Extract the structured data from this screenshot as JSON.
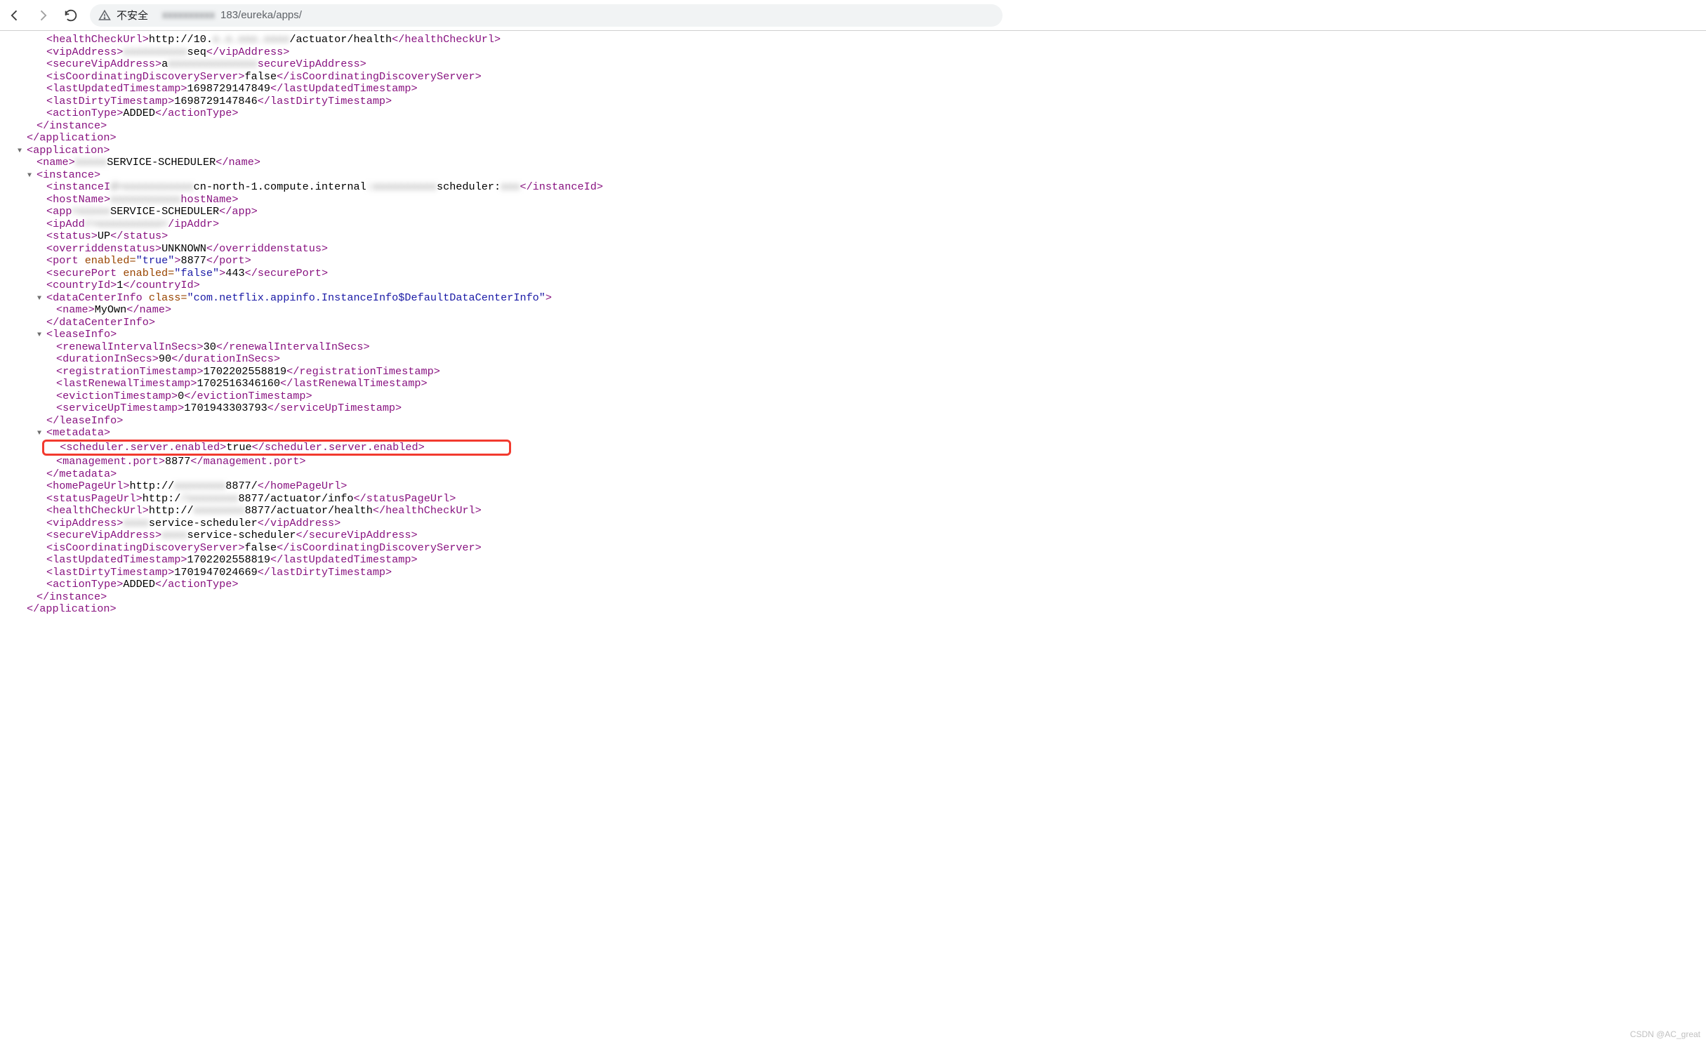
{
  "toolbar": {
    "insecure_label": "不安全",
    "url_port_path": "183/eureka/apps/"
  },
  "prev_instance": {
    "healthCheckUrl_prefix": "http://10.",
    "healthCheckUrl_suffix": "/actuator/health",
    "vipAddress_suffix": "seq",
    "secureVipAddress_prefix": "a",
    "isCoordinatingDiscoveryServer": "false",
    "lastUpdatedTimestamp": "1698729147849",
    "lastDirtyTimestamp": "1698729147846",
    "actionType": "ADDED"
  },
  "app": {
    "name_suffix": "SERVICE-SCHEDULER",
    "instance": {
      "instanceId_mid": "cn-north-1.compute.internal",
      "instanceId_tail": "scheduler:",
      "hostName_label": "hostName",
      "app_suffix": "SERVICE-SCHEDULER",
      "ipAddr_close": "/ipAddr",
      "status": "UP",
      "overriddenstatus": "UNKNOWN",
      "port_enabled": "true",
      "port": "8877",
      "securePort_enabled": "false",
      "securePort": "443",
      "countryId": "1",
      "dataCenterInfo": {
        "class": "com.netflix.appinfo.InstanceInfo$DefaultDataCenterInfo",
        "name": "MyOwn"
      },
      "leaseInfo": {
        "renewalIntervalInSecs": "30",
        "durationInSecs": "90",
        "registrationTimestamp": "1702202558819",
        "lastRenewalTimestamp": "1702516346160",
        "evictionTimestamp": "0",
        "serviceUpTimestamp": "1701943303793"
      },
      "metadata": {
        "scheduler_server_enabled": "true",
        "management_port": "8877"
      },
      "homePageUrl_prefix": "http://",
      "homePageUrl_suffix": "8877/",
      "statusPageUrl_prefix": "http:/",
      "statusPageUrl_suffix": "8877/actuator/info",
      "healthCheckUrl_prefix": "http://",
      "healthCheckUrl_suffix": "8877/actuator/health",
      "vipAddress": "service-scheduler",
      "secureVipAddress": "service-scheduler",
      "isCoordinatingDiscoveryServer": "false",
      "lastUpdatedTimestamp": "1702202558819",
      "lastDirtyTimestamp": "1701947024669",
      "actionType": "ADDED"
    }
  },
  "watermark": "CSDN @AC_great"
}
